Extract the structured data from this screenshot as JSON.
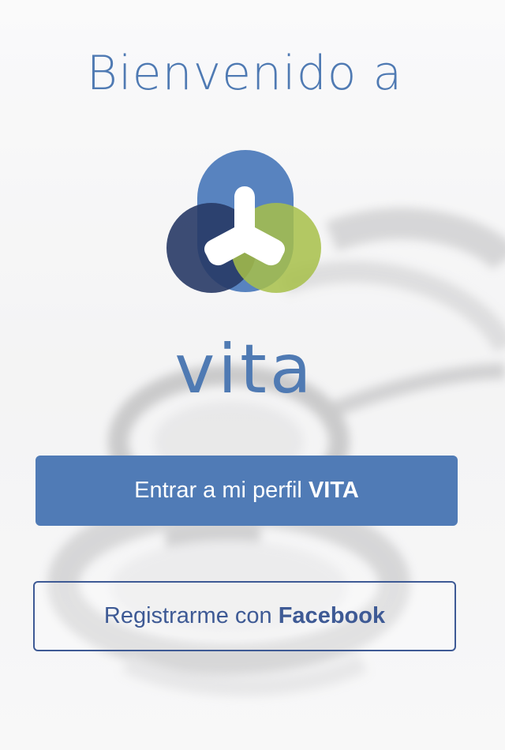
{
  "welcome": {
    "title": "Bienvenido a"
  },
  "brand": {
    "name": "vita",
    "logo_icon": "vita-logo-icon"
  },
  "actions": {
    "login_prefix": "Entrar a mi perfil ",
    "login_brand": "VITA",
    "facebook_prefix": "Registrarme con ",
    "facebook_brand": "Facebook"
  },
  "colors": {
    "accent": "#507bb6",
    "facebook": "#3e5a95",
    "logo_blue": "#4f7cbc",
    "logo_navy": "#283a66",
    "logo_green": "#a7bf49"
  },
  "background": {
    "image": "stethoscope-background"
  }
}
